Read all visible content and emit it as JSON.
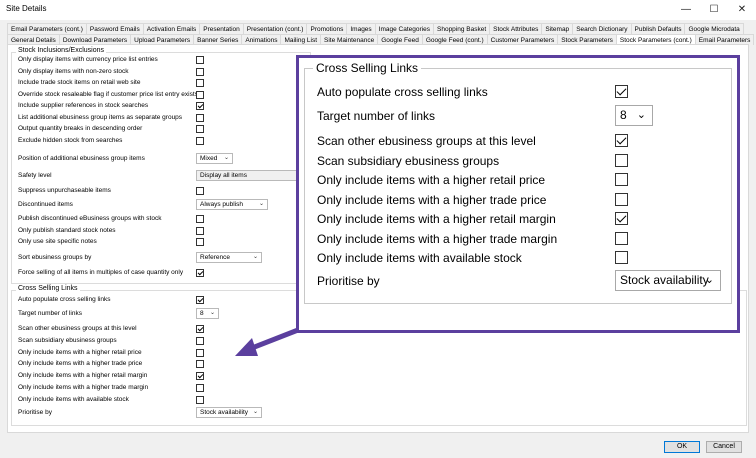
{
  "window": {
    "title": "Site Details",
    "minimize_glyph": "—",
    "maximize_glyph": "☐",
    "close_glyph": "✕"
  },
  "tabs_row1": [
    "Email Parameters (cont.)",
    "Password Emails",
    "Activation Emails",
    "Presentation",
    "Presentation (cont.)",
    "Promotions",
    "Images",
    "Image Categories",
    "Shopping Basket",
    "Stock Attributes",
    "Sitemap",
    "Search Dictionary",
    "Publish Defaults",
    "Google Microdata"
  ],
  "tabs_row2": [
    "General Details",
    "Download Parameters",
    "Upload Parameters",
    "Banner Series",
    "Animations",
    "Mailing List",
    "Site Maintenance",
    "Google Feed",
    "Google Feed (cont.)",
    "Customer Parameters",
    "Stock Parameters",
    "Stock Parameters (cont.)",
    "Email Parameters"
  ],
  "active_tab": "Stock Parameters (cont.)",
  "stock_group": {
    "title": "Stock Inclusions/Exclusions",
    "rows": [
      {
        "label": "Only display items with currency price list entries",
        "checked": false
      },
      {
        "label": "Only display items with non-zero stock",
        "checked": false
      },
      {
        "label": "Include trade stock items on retail web site",
        "checked": false
      },
      {
        "label": "Override stock resaleable flag if customer price list entry exists",
        "checked": false
      },
      {
        "label": "Include supplier references in stock searches",
        "checked": true
      },
      {
        "label": "List additional ebusiness group items as separate groups",
        "checked": false
      },
      {
        "label": "Output quantity breaks in descending order",
        "checked": false
      },
      {
        "label": "Exclude hidden stock from searches",
        "checked": false
      }
    ],
    "position_label": "Position of additional ebusiness group items",
    "position_value": "Mixed",
    "safety_label": "Safety level",
    "safety_value": "Display all items",
    "suppress_label": "Suppress unpurchaseable items",
    "discontinued_label": "Discontinued items",
    "discontinued_value": "Always publish",
    "rows2": [
      {
        "label": "Publish discontinued eBusiness groups with stock",
        "checked": false
      },
      {
        "label": "Only publish standard stock notes",
        "checked": false
      },
      {
        "label": "Only use site specific notes",
        "checked": false
      }
    ],
    "sort_label": "Sort ebusiness groups by",
    "sort_value": "Reference",
    "force_label": "Force selling of all items in multiples of case quantity only",
    "force_checked": true
  },
  "cross_group": {
    "title": "Cross Selling Links",
    "auto_label": "Auto populate cross selling links",
    "auto_checked": true,
    "target_label": "Target number of links",
    "target_value": "8",
    "rows": [
      {
        "label": "Scan other ebusiness groups at this level",
        "checked": true
      },
      {
        "label": "Scan subsidiary ebusiness groups",
        "checked": false
      },
      {
        "label": "Only include items with a higher retail price",
        "checked": false
      },
      {
        "label": "Only include items with a higher trade price",
        "checked": false
      },
      {
        "label": "Only include items with a higher retail margin",
        "checked": true
      },
      {
        "label": "Only include items with a higher trade margin",
        "checked": false
      },
      {
        "label": "Only include items with available stock",
        "checked": false
      }
    ],
    "prioritise_label": "Prioritise by",
    "prioritise_value": "Stock availability"
  },
  "buttons": {
    "ok": "OK",
    "cancel": "Cancel"
  },
  "colors": {
    "callout_border": "#5b3f9e",
    "arrow": "#5b3f9e"
  }
}
